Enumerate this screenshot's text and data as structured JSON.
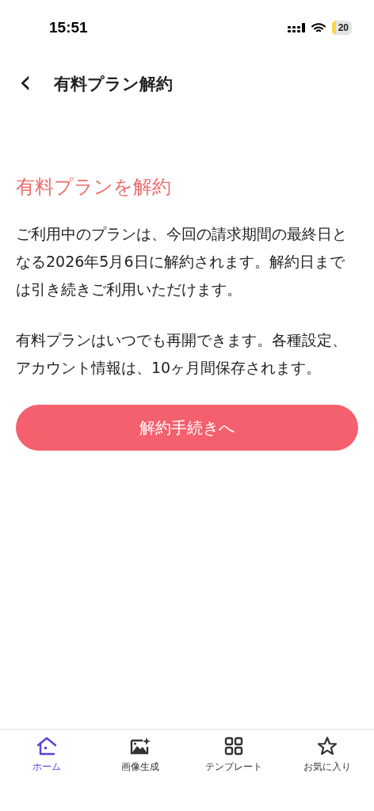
{
  "status_bar": {
    "time": "15:51",
    "battery": "20"
  },
  "header": {
    "back": "‹",
    "title": "有料プラン解約"
  },
  "heading": "有料プランを解約",
  "paragraphs": [
    "ご利用中のプランは、今回の請求期間の最終日となる2026年5月6日に解約されます。解約日までは引き続きご利用いただけます。",
    "有料プランはいつでも再開できます。各種設定、アカウント情報は、10ヶ月間保存されます。"
  ],
  "button": "解約手続きへ",
  "tabs": [
    {
      "kind": "home",
      "label": "ホーム",
      "selected": true
    },
    {
      "kind": "image",
      "label": "画像生成",
      "selected": false
    },
    {
      "kind": "grid",
      "label": "テンプレート",
      "selected": false
    },
    {
      "kind": "star",
      "label": "お気に入り",
      "selected": false
    }
  ]
}
